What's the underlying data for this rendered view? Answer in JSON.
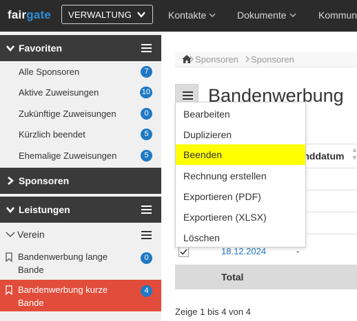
{
  "app": {
    "logo_prefix": "fair",
    "logo_suffix": "gate",
    "area_select": "VERWALTUNG",
    "nav": [
      "Kontakte",
      "Dokumente",
      "Kommun"
    ]
  },
  "sidebar": {
    "favoriten": {
      "label": "Favoriten",
      "items": [
        {
          "label": "Alle Sponsoren",
          "count": "7"
        },
        {
          "label": "Aktive Zuweisungen",
          "count": "10"
        },
        {
          "label": "Zukünftige Zuweisungen",
          "count": "0"
        },
        {
          "label": "Kürzlich beendet",
          "count": "5"
        },
        {
          "label": "Ehemalige Zuweisungen",
          "count": "5"
        }
      ]
    },
    "sponsoren": {
      "label": "Sponsoren"
    },
    "leistungen": {
      "label": "Leistungen",
      "verein": "Verein",
      "items": [
        {
          "label": "Bandenwerbung lange Bande",
          "count": "0"
        },
        {
          "label": "Bandenwerbung kurze Bande",
          "count": "4"
        }
      ]
    }
  },
  "main": {
    "breadcrumb": [
      "Sponsoren",
      "Sponsoren"
    ],
    "title": "Bandenwerbung",
    "column_enddatum": "Enddatum",
    "row_date": "18.12.2024",
    "row_dash": "-",
    "total_label": "Total",
    "summary": "Zeige 1 bis 4 von 4"
  },
  "dropdown": {
    "items": [
      "Bearbeiten",
      "Duplizieren",
      "Beenden",
      "Rechnung erstellen",
      "Exportieren (PDF)",
      "Exportieren (XLSX)",
      "Löschen"
    ],
    "highlighted": "Beenden",
    "highlight_color": "#ffff00"
  },
  "colors": {
    "topbar": "#2b2b2b",
    "accent": "#2e8fd6",
    "badge": "#1f79c4",
    "active_item": "#e24c3b"
  }
}
